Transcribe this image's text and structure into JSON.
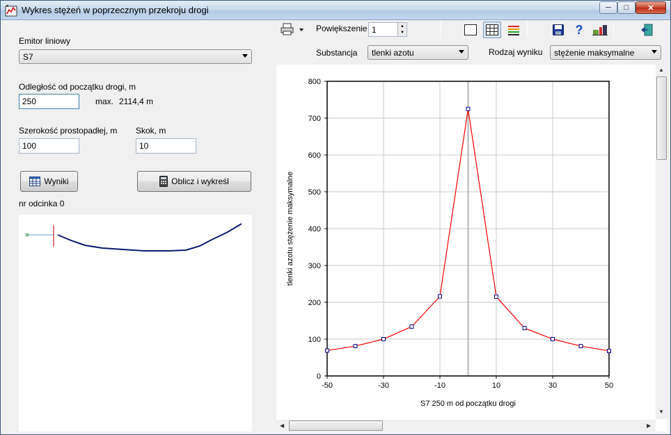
{
  "window": {
    "title": "Wykres stężeń w  poprzecznym przekroju drogi"
  },
  "left": {
    "emitor_label": "Emitor liniowy",
    "emitor_value": "S7",
    "distance_label": "Odległość od początku drogi, m",
    "distance_value": "250",
    "max_label": "max.",
    "max_value": "2114,4 m",
    "width_label": "Szerokość prostopadłej, m",
    "width_value": "100",
    "step_label": "Skok, m",
    "step_value": "10",
    "results_button": "Wyniki",
    "calc_button": "Oblicz i wykreśl",
    "segment_label": "nr odcinka 0"
  },
  "toolbar": {
    "zoom_label": "Powiększenie",
    "zoom_value": "1",
    "substance_label": "Substancja",
    "substance_value": "tlenki azotu",
    "result_type_label": "Rodzaj wyniku",
    "result_type_value": "stężenie maksymalne"
  },
  "icons": [
    "print-icon",
    "dropdown-arrow-icon",
    "chart-frame-icon",
    "grid-icon",
    "legend-icon",
    "save-icon",
    "help-icon",
    "settings-icon",
    "exit-icon"
  ],
  "chart_data": {
    "type": "line",
    "title": "",
    "xlabel": "S7  250 m od początku drogi",
    "ylabel": "tlenki azotu stężenie maksymalne",
    "xlim": [
      -50,
      50
    ],
    "ylim": [
      0,
      800
    ],
    "xticks": [
      -50,
      -30,
      -10,
      10,
      30,
      50
    ],
    "yticks": [
      0,
      100,
      200,
      300,
      400,
      500,
      600,
      700,
      800
    ],
    "grid": true,
    "series": [
      {
        "color": "#ff0000",
        "x": [
          -50,
          -40,
          -30,
          -20,
          -10,
          0,
          10,
          20,
          30,
          40,
          50
        ],
        "y": [
          69,
          81,
          100,
          134,
          216,
          725,
          215,
          130,
          100,
          81,
          68
        ]
      }
    ]
  }
}
